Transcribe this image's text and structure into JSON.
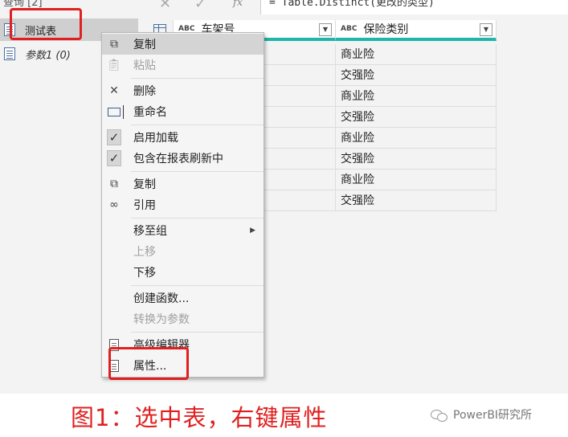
{
  "left_pane": {
    "top_cut_text": "查询 [2]",
    "queries": [
      {
        "label": "测试表",
        "selected": true
      },
      {
        "label": "参数1 (0)",
        "selected": false
      }
    ]
  },
  "formula_bar": {
    "cancel_icon": "x-icon",
    "confirm_icon": "check-icon",
    "fx_label": "fx",
    "formula": "= Table.Distinct(更改的类型)"
  },
  "grid": {
    "columns": [
      {
        "type_badge": "ABC",
        "name": "车架号"
      },
      {
        "type_badge": "ABC",
        "name": "保险类别"
      }
    ],
    "rows": [
      [
        "",
        "商业险"
      ],
      [
        "",
        "交强险"
      ],
      [
        "",
        "商业险"
      ],
      [
        "",
        "交强险"
      ],
      [
        "",
        "商业险"
      ],
      [
        "",
        "交强险"
      ],
      [
        "",
        "商业险"
      ],
      [
        "",
        "交强险"
      ]
    ]
  },
  "context_menu": {
    "items": [
      {
        "label": "复制",
        "icon": "copy-icon",
        "highlighted": true
      },
      {
        "label": "粘贴",
        "icon": "paste-icon",
        "disabled": true
      },
      {
        "label": "删除",
        "icon": "delete-icon"
      },
      {
        "label": "重命名",
        "icon": "rename-icon"
      },
      {
        "label": "启用加载",
        "icon": "checkbox-checked-icon"
      },
      {
        "label": "包含在报表刷新中",
        "icon": "checkbox-checked-icon"
      },
      {
        "label": "复制",
        "icon": "duplicate-icon"
      },
      {
        "label": "引用",
        "icon": "reference-icon"
      },
      {
        "label": "移至组",
        "icon": "",
        "submenu": true
      },
      {
        "label": "上移",
        "icon": "",
        "disabled": true
      },
      {
        "label": "下移",
        "icon": ""
      },
      {
        "label": "创建函数...",
        "icon": ""
      },
      {
        "label": "转换为参数",
        "icon": "",
        "disabled": true
      },
      {
        "label": "高级编辑器",
        "icon": "document-icon"
      },
      {
        "label": "属性...",
        "icon": "properties-icon"
      }
    ]
  },
  "caption": "图1：选中表，右键属性",
  "watermark": "PowerBI研究所",
  "colors": {
    "highlight_red": "#e02020",
    "header_accent": "#1fb5a8"
  }
}
